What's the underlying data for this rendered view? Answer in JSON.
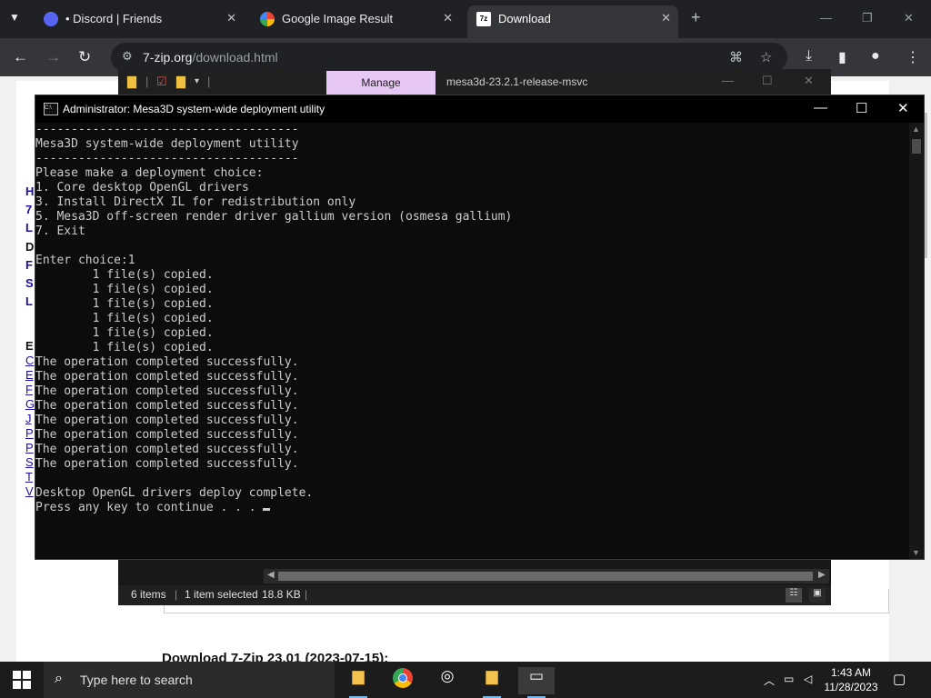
{
  "browser": {
    "tabs": [
      {
        "label": "• Discord | Friends",
        "active": false
      },
      {
        "label": "Google Image Result",
        "active": false
      },
      {
        "label": "Download",
        "active": true
      }
    ],
    "url_host": "7-zip.org",
    "url_path": "/download.html",
    "icons": {
      "tab_list": "chevron-down-icon",
      "new_tab": "plus-icon",
      "back": "arrow-left-icon",
      "forward": "arrow-right-icon",
      "reload": "reload-icon",
      "site_info": "tune-icon",
      "translate": "translate-icon",
      "bookmark": "star-icon",
      "downloads": "download-icon",
      "side_panel": "side-panel-icon",
      "profile": "profile-icon",
      "menu": "kebab-menu-icon"
    }
  },
  "webpage": {
    "sidebar_letters": [
      "H",
      "7",
      "L",
      "D",
      "F",
      "S",
      "L"
    ],
    "section_letter": "E",
    "link_letters": [
      "C",
      "E",
      "F",
      "G",
      "J",
      "P",
      "P",
      "S",
      "T",
      "V"
    ],
    "heading": "Download 7-Zip 23.01 (2023-07-15):"
  },
  "explorer": {
    "manage_label": "Manage",
    "folder_name": "mesa3d-23.2.1-release-msvc",
    "status_items": "6 items",
    "status_selected": "1 item selected",
    "status_size": "18.8 KB"
  },
  "console": {
    "title": "Administrator:  Mesa3D system-wide deployment utility",
    "lines": [
      "-------------------------------------",
      "Mesa3D system-wide deployment utility",
      "-------------------------------------",
      "Please make a deployment choice:",
      "1. Core desktop OpenGL drivers",
      "3. Install DirectX IL for redistribution only",
      "5. Mesa3D off-screen render driver gallium version (osmesa gallium)",
      "7. Exit",
      "",
      "Enter choice:1",
      "        1 file(s) copied.",
      "        1 file(s) copied.",
      "        1 file(s) copied.",
      "        1 file(s) copied.",
      "        1 file(s) copied.",
      "        1 file(s) copied.",
      "The operation completed successfully.",
      "The operation completed successfully.",
      "The operation completed successfully.",
      "The operation completed successfully.",
      "The operation completed successfully.",
      "The operation completed successfully.",
      "The operation completed successfully.",
      "The operation completed successfully.",
      "",
      "Desktop OpenGL drivers deploy complete.",
      "Press any key to continue . . . "
    ]
  },
  "taskbar": {
    "search_placeholder": "Type here to search",
    "time": "1:43 AM",
    "date": "11/28/2023",
    "apps": [
      "file-explorer-icon",
      "chrome-icon",
      "obs-icon",
      "folder-app-icon",
      "terminal-icon"
    ]
  },
  "colors": {
    "console_bg": "#0c0c0c",
    "console_text": "#cccccc",
    "manage_tab": "#e7c8f5",
    "chrome_dark": "#202124",
    "link_blue": "#1a0dab"
  }
}
